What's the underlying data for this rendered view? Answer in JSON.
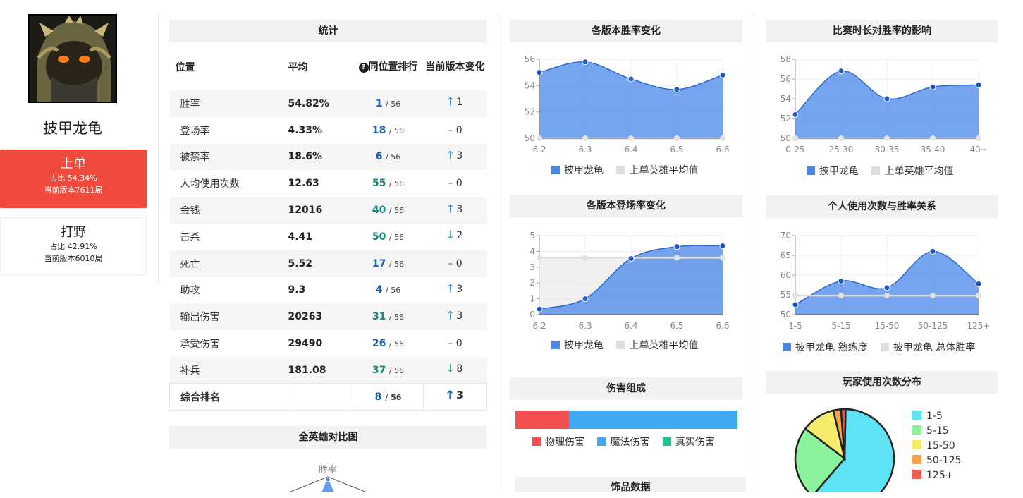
{
  "hero": {
    "name": "披甲龙龟",
    "roles": [
      {
        "name": "上单",
        "share": "占比 54.34%",
        "games": "当前版本7611局",
        "active": true
      },
      {
        "name": "打野",
        "share": "占比 42.91%",
        "games": "当前版本6010局",
        "active": false
      }
    ]
  },
  "stats": {
    "title": "统计",
    "headers": {
      "pos": "位置",
      "avg": "平均",
      "rank": "同位置排行",
      "change": "当前版本变化"
    },
    "rows": [
      {
        "label": "胜率",
        "avg": "54.82%",
        "rank": "1",
        "total": "/ 56",
        "color": "blue",
        "dir": "up",
        "delta": "1"
      },
      {
        "label": "登场率",
        "avg": "4.33%",
        "rank": "18",
        "total": "/ 56",
        "color": "blue",
        "dir": "none",
        "delta": "0"
      },
      {
        "label": "被禁率",
        "avg": "18.6%",
        "rank": "6",
        "total": "/ 56",
        "color": "blue",
        "dir": "up",
        "delta": "3"
      },
      {
        "label": "人均使用次数",
        "avg": "12.63",
        "rank": "55",
        "total": "/ 56",
        "color": "green",
        "dir": "none",
        "delta": "0"
      },
      {
        "label": "金钱",
        "avg": "12016",
        "rank": "40",
        "total": "/ 56",
        "color": "green",
        "dir": "up",
        "delta": "3"
      },
      {
        "label": "击杀",
        "avg": "4.41",
        "rank": "50",
        "total": "/ 56",
        "color": "green",
        "dir": "down",
        "delta": "2"
      },
      {
        "label": "死亡",
        "avg": "5.52",
        "rank": "17",
        "total": "/ 56",
        "color": "blue",
        "dir": "none",
        "delta": "0"
      },
      {
        "label": "助攻",
        "avg": "9.3",
        "rank": "4",
        "total": "/ 56",
        "color": "blue",
        "dir": "up",
        "delta": "3"
      },
      {
        "label": "输出伤害",
        "avg": "20263",
        "rank": "31",
        "total": "/ 56",
        "color": "green",
        "dir": "up",
        "delta": "3"
      },
      {
        "label": "承受伤害",
        "avg": "29490",
        "rank": "26",
        "total": "/ 56",
        "color": "blue",
        "dir": "none",
        "delta": "0"
      },
      {
        "label": "补兵",
        "avg": "181.08",
        "rank": "37",
        "total": "/ 56",
        "color": "green",
        "dir": "down",
        "delta": "8"
      }
    ],
    "overall": {
      "label": "综合排名",
      "rank": "8",
      "total": "/ 56",
      "dir": "up",
      "delta": "3"
    }
  },
  "compare": {
    "title": "全英雄对比图",
    "axis_label": "胜率"
  },
  "colors": {
    "hero_series": "#4a86e8",
    "avg_series": "#dddddd",
    "role_active": "#f04a3c",
    "phys": "#f05050",
    "magic": "#3fa9f5",
    "true": "#1fc48b"
  },
  "legend_hero": "披甲龙龟",
  "legend_avg": "上单英雄平均值",
  "chart_data": [
    {
      "id": "winrate_patch",
      "type": "area",
      "title": "各版本胜率变化",
      "x": [
        "6.2",
        "6.3",
        "6.4",
        "6.5",
        "6.6"
      ],
      "ylim": [
        50,
        56
      ],
      "yticks": [
        50,
        52,
        54,
        56
      ],
      "series": [
        {
          "name": "披甲龙龟",
          "values": [
            55.0,
            55.8,
            54.5,
            53.7,
            54.8
          ]
        },
        {
          "name": "上单英雄平均值",
          "values": [
            50,
            50,
            50,
            50,
            50
          ]
        }
      ]
    },
    {
      "id": "duration",
      "type": "area",
      "title": "比赛时长对胜率的影响",
      "x": [
        "0-25",
        "25-30",
        "30-35",
        "35-40",
        "40+"
      ],
      "ylim": [
        50,
        58
      ],
      "yticks": [
        50,
        52,
        54,
        56,
        58
      ],
      "series": [
        {
          "name": "披甲龙龟",
          "values": [
            52.4,
            56.8,
            54.0,
            55.2,
            55.4
          ]
        },
        {
          "name": "上单英雄平均值",
          "values": [
            50,
            50,
            50,
            50,
            50
          ]
        }
      ]
    },
    {
      "id": "pickrate_patch",
      "type": "area",
      "title": "各版本登场率变化",
      "x": [
        "6.2",
        "6.3",
        "6.4",
        "6.5",
        "6.6"
      ],
      "ylim": [
        0,
        5
      ],
      "yticks": [
        0,
        1,
        2,
        3,
        4,
        5
      ],
      "series": [
        {
          "name": "披甲龙龟",
          "values": [
            0.35,
            1.0,
            3.55,
            4.3,
            4.35
          ]
        },
        {
          "name": "上单英雄平均值",
          "values": [
            3.6,
            3.6,
            3.6,
            3.6,
            3.6
          ]
        }
      ]
    },
    {
      "id": "games_winrate",
      "type": "area",
      "title": "个人使用次数与胜率关系",
      "x": [
        "1-5",
        "5-15",
        "15-50",
        "50-125",
        "125+"
      ],
      "ylim": [
        50,
        70
      ],
      "yticks": [
        50,
        55,
        60,
        65,
        70
      ],
      "series": [
        {
          "name": "披甲龙龟 熟练度",
          "values": [
            52.5,
            58.5,
            56.8,
            66.0,
            57.8
          ]
        },
        {
          "name": "披甲龙龟 总体胜率",
          "values": [
            54.8,
            54.8,
            54.8,
            54.8,
            54.8
          ]
        }
      ]
    },
    {
      "id": "damage",
      "type": "bar",
      "title": "伤害组成",
      "categories": [
        "物理伤害",
        "魔法伤害",
        "真实伤害"
      ],
      "values": [
        24,
        75,
        1
      ]
    },
    {
      "id": "games_dist",
      "type": "pie",
      "title": "玩家使用次数分布",
      "categories": [
        "1-5",
        "5-15",
        "15-50",
        "50-125",
        "125+"
      ],
      "values": [
        61,
        24,
        11,
        2.5,
        1.5
      ],
      "colors": [
        "#5ee3f5",
        "#8cf29b",
        "#f5ec6e",
        "#f5a24a",
        "#f05a50"
      ]
    }
  ],
  "trinket_title": "饰品数据"
}
